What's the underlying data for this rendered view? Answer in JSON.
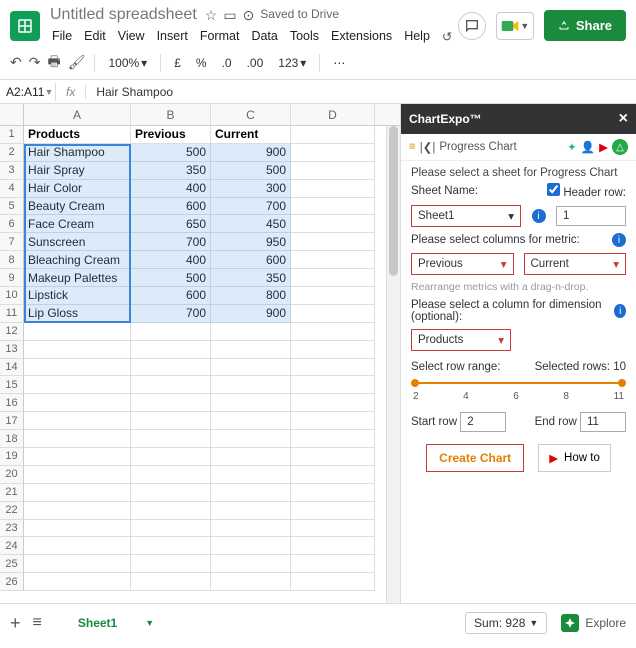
{
  "doc_title": "Untitled spreadsheet",
  "saved_text": "Saved to Drive",
  "menu": [
    "File",
    "Edit",
    "View",
    "Insert",
    "Format",
    "Data",
    "Tools",
    "Extensions",
    "Help"
  ],
  "share_label": "Share",
  "zoom": "100%",
  "currency": [
    "£",
    "%"
  ],
  "num_fmt": [
    ".0",
    ".00",
    "123"
  ],
  "cell_ref": "A2:A11",
  "fx_label": "fx",
  "formula_value": "Hair Shampoo",
  "columns": [
    "A",
    "B",
    "C",
    "D"
  ],
  "headers": [
    "Products",
    "Previous",
    "Current"
  ],
  "rows": [
    [
      "Hair Shampoo",
      "500",
      "900"
    ],
    [
      "Hair Spray",
      "350",
      "500"
    ],
    [
      "Hair Color",
      "400",
      "300"
    ],
    [
      "Beauty Cream",
      "600",
      "700"
    ],
    [
      "Face Cream",
      "650",
      "450"
    ],
    [
      "Sunscreen",
      "700",
      "950"
    ],
    [
      "Bleaching Cream",
      "400",
      "600"
    ],
    [
      "Makeup Palettes",
      "500",
      "350"
    ],
    [
      "Lipstick",
      "600",
      "800"
    ],
    [
      "Lip Gloss",
      "700",
      "900"
    ]
  ],
  "panel": {
    "title": "ChartExpo™",
    "subtitle": "Progress Chart",
    "select_sheet_label": "Please select a sheet for Progress Chart",
    "sheet_name_label": "Sheet Name:",
    "header_row_label": "Header row:",
    "sheet_name_value": "Sheet1",
    "header_row_value": "1",
    "metric_label": "Please select columns for metric:",
    "metric1": "Previous",
    "metric2": "Current",
    "rearrange_hint": "Rearrange metrics with a drag-n-drop.",
    "dimension_label": "Please select a column for dimension (optional):",
    "dimension_value": "Products",
    "range_label": "Select row range:",
    "selected_rows": "Selected rows: 10",
    "ticks": [
      "2",
      "4",
      "6",
      "8",
      "11"
    ],
    "start_row_label": "Start row",
    "start_row_value": "2",
    "end_row_label": "End row",
    "end_row_value": "11",
    "create_btn": "Create Chart",
    "howto_btn": "How to"
  },
  "sheet_tab": "Sheet1",
  "sum_label": "Sum: 928",
  "explore_label": "Explore",
  "chart_data": {
    "type": "table",
    "categories": [
      "Hair Shampoo",
      "Hair Spray",
      "Hair Color",
      "Beauty Cream",
      "Face Cream",
      "Sunscreen",
      "Bleaching Cream",
      "Makeup Palettes",
      "Lipstick",
      "Lip Gloss"
    ],
    "series": [
      {
        "name": "Previous",
        "values": [
          500,
          350,
          400,
          600,
          650,
          700,
          400,
          500,
          600,
          700
        ]
      },
      {
        "name": "Current",
        "values": [
          900,
          500,
          300,
          700,
          450,
          950,
          600,
          350,
          800,
          900
        ]
      }
    ],
    "title": "Progress Chart"
  }
}
